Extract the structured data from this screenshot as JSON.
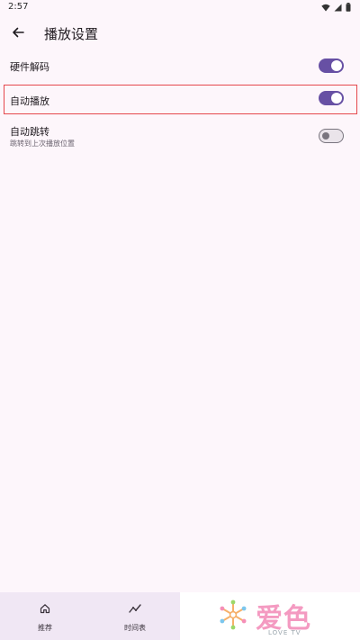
{
  "status_bar": {
    "time": "2:57"
  },
  "app_bar": {
    "title": "播放设置"
  },
  "settings": [
    {
      "title": "硬件解码",
      "subtitle": "",
      "enabled": true
    },
    {
      "title": "自动播放",
      "subtitle": "",
      "enabled": true
    },
    {
      "title": "自动跳转",
      "subtitle": "跳转到上次播放位置",
      "enabled": false
    }
  ],
  "bottom_nav": [
    {
      "label": "推荐",
      "icon": "home-icon"
    },
    {
      "label": "时间表",
      "icon": "trend-icon"
    }
  ],
  "watermark": {
    "text": "爱色",
    "subtext": "LOVE TV"
  },
  "colors": {
    "accent": "#6750a4",
    "highlight": "#e5484d",
    "background": "#fdf6fb"
  }
}
